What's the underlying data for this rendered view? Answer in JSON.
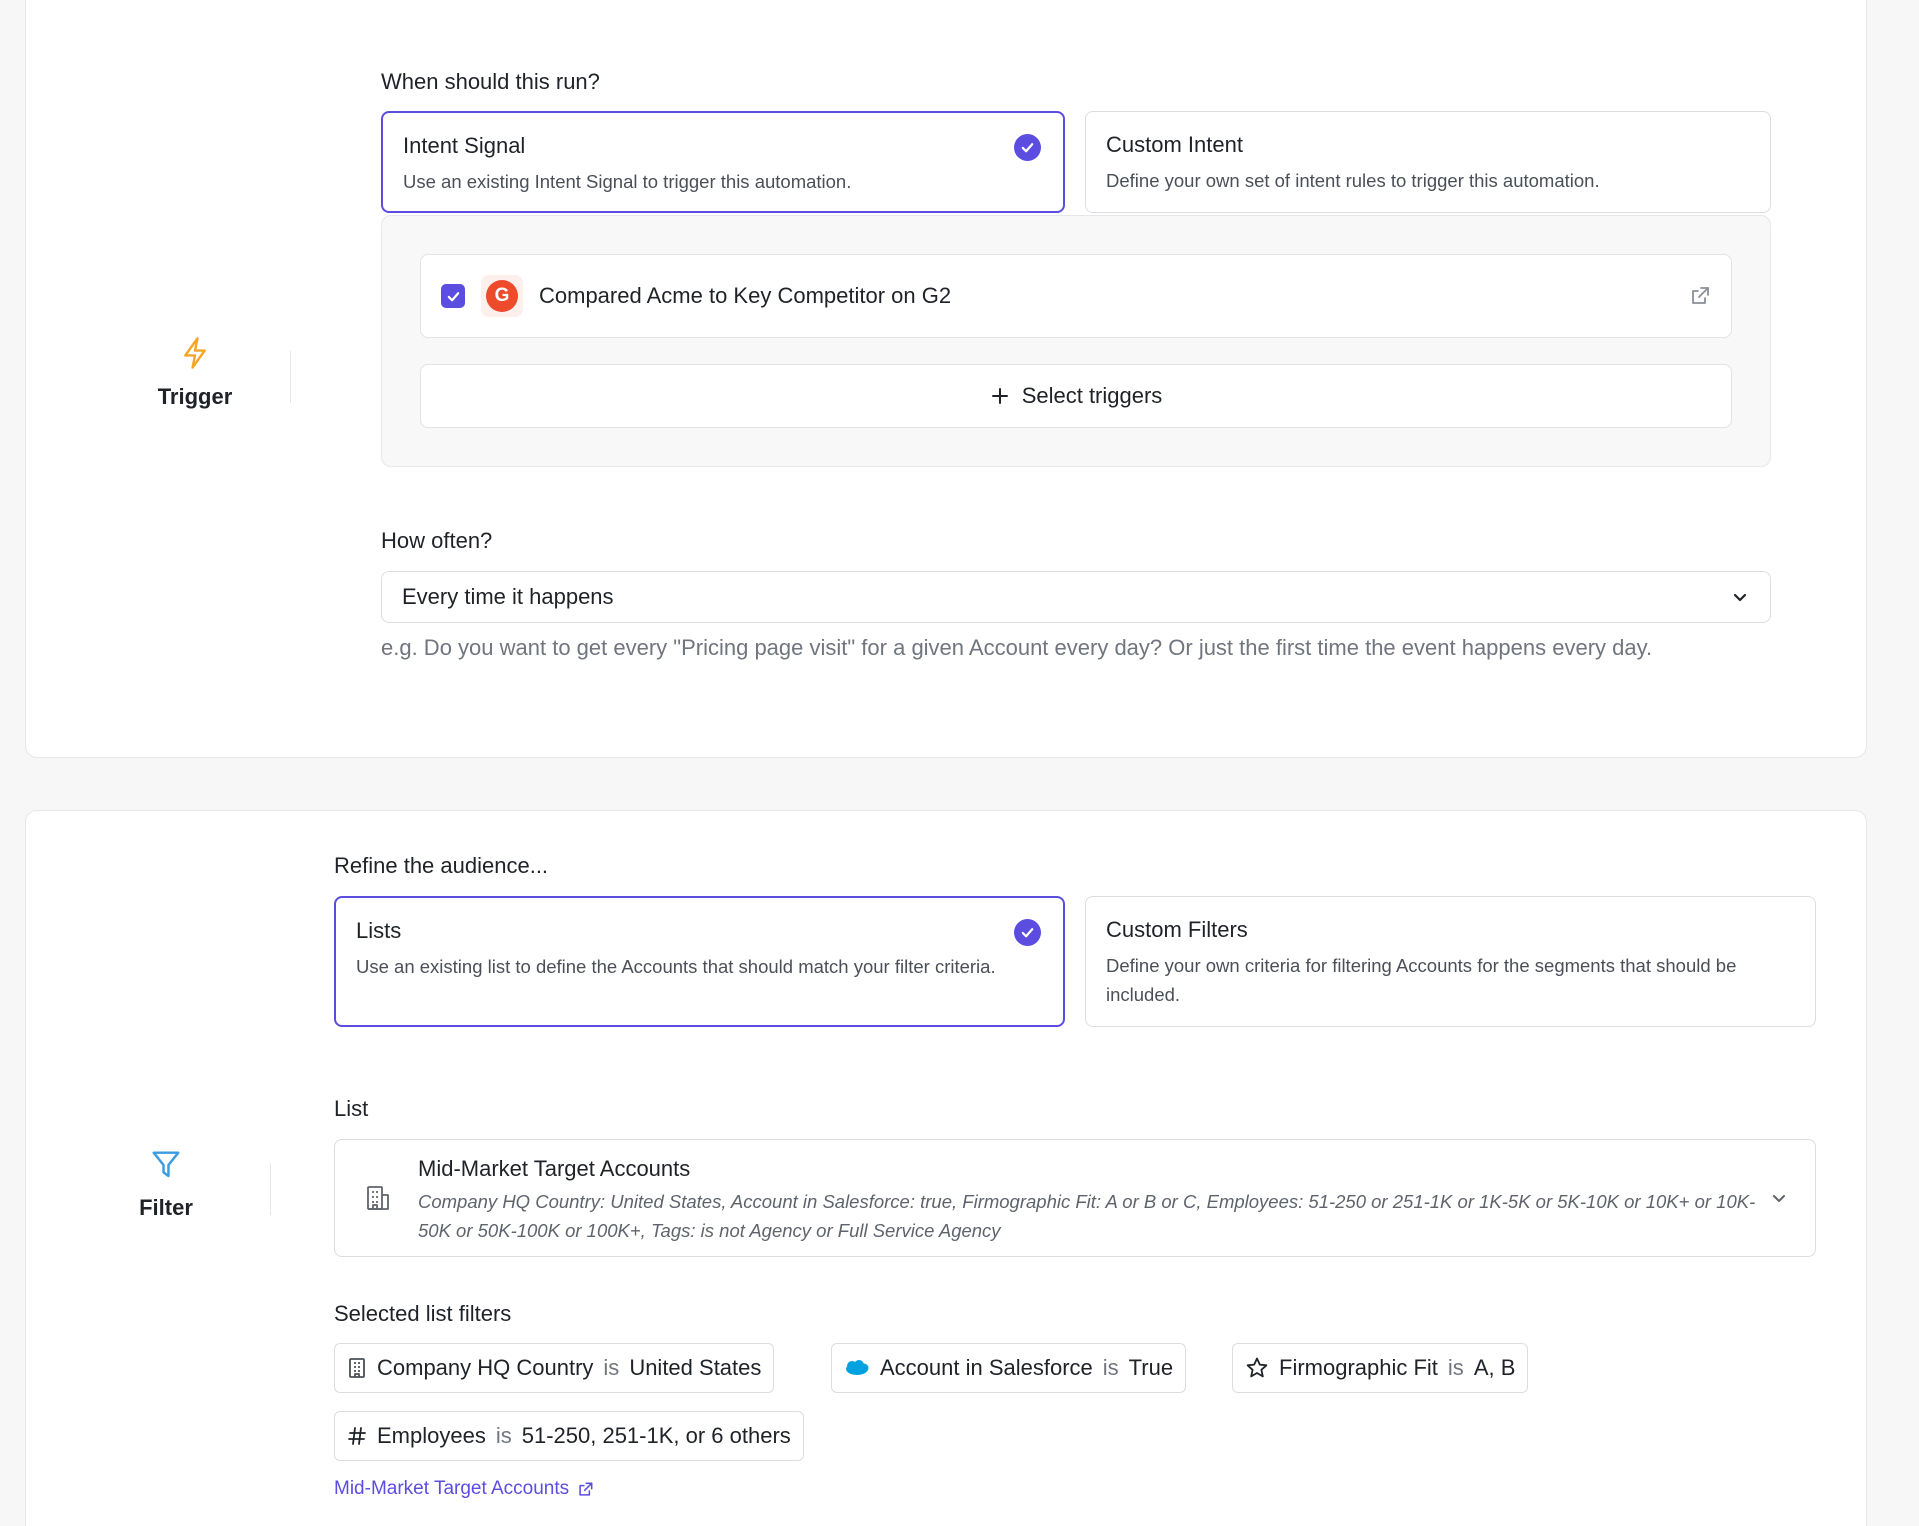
{
  "trigger": {
    "section_label": "Trigger",
    "question": "When should this run?",
    "options": [
      {
        "title": "Intent Signal",
        "desc": "Use an existing Intent Signal to trigger this automation."
      },
      {
        "title": "Custom Intent",
        "desc": "Define your own set of intent rules to trigger this automation."
      }
    ],
    "selected_trigger": {
      "name": "Compared Acme to Key Competitor on G2",
      "logo_letter": "G"
    },
    "add_label": "Select triggers",
    "frequency_question": "How often?",
    "frequency_value": "Every time it happens",
    "frequency_hint": "e.g. Do you want to get every \"Pricing page visit\" for a given Account every day? Or just the first time the event happens every day."
  },
  "filter": {
    "section_label": "Filter",
    "question": "Refine the audience...",
    "options": [
      {
        "title": "Lists",
        "desc": "Use an existing list to define the Accounts that should match your filter criteria."
      },
      {
        "title": "Custom Filters",
        "desc": "Define your own criteria for filtering Accounts for the segments that should be included."
      }
    ],
    "list_label": "List",
    "list_name": "Mid-Market Target Accounts",
    "list_desc": "Company HQ Country: United States, Account in Salesforce: true, Firmographic Fit: A or B or C, Employees: 51-250 or 251-1K or 1K-5K or 5K-10K or 10K+ or 10K-50K or 50K-100K or 100K+, Tags: is not Agency or Full Service Agency",
    "selected_filters_label": "Selected list filters",
    "chips": [
      {
        "field": "Company HQ Country",
        "op": "is",
        "value": "United States",
        "icon": "building-icon"
      },
      {
        "field": "Account in Salesforce",
        "op": "is",
        "value": "True",
        "icon": "salesforce-icon"
      },
      {
        "field": "Firmographic Fit",
        "op": "is",
        "value": "A, B",
        "icon": "star-icon"
      },
      {
        "field": "Employees",
        "op": "is",
        "value": "51-250, 251-1K, or 6 others",
        "icon": "hash-icon"
      }
    ],
    "list_link": "Mid-Market Target Accounts"
  },
  "colors": {
    "accent": "#5b4de0",
    "trigger_icon": "#f5a524",
    "filter_icon": "#3b9ce0",
    "g2": "#ee4a2c",
    "salesforce": "#00a1e0"
  }
}
